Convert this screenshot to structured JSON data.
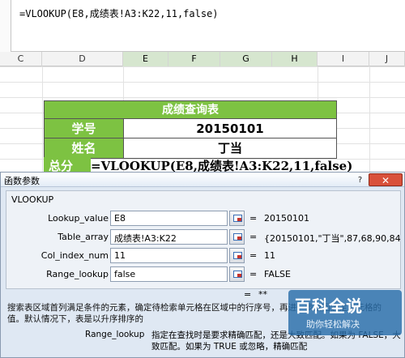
{
  "formula_bar": {
    "text": "=VLOOKUP(E8,成绩表!A3:K22,11,false)"
  },
  "columns": [
    "C",
    "D",
    "E",
    "F",
    "G",
    "H",
    "I",
    "J"
  ],
  "table": {
    "title": "成绩查询表",
    "rows": [
      {
        "label": "学号",
        "value": "20150101"
      },
      {
        "label": "姓名",
        "value": "丁当"
      }
    ],
    "overlay_label": "总分",
    "overlay_formula": "=VLOOKUP(E8,成绩表!A3:K22,11,false)"
  },
  "dialog": {
    "title": "函数参数",
    "help": "?",
    "close": "✕",
    "function_name": "VLOOKUP",
    "args": [
      {
        "label": "Lookup_value",
        "value": "E8",
        "result": "20150101"
      },
      {
        "label": "Table_array",
        "value": "成绩表!A3:K22",
        "result": "{20150101,\"丁当\",87,68,90,84,85,41"
      },
      {
        "label": "Col_index_num",
        "value": "11",
        "result": "11"
      },
      {
        "label": "Range_lookup",
        "value": "false",
        "result": "FALSE"
      }
    ],
    "equals": "=",
    "total_result": "**",
    "description": "搜索表区域首列满足条件的元素，确定待检索单元格在区域中的行序号，再进一步返回选定单元格的值。默认情况下，表是以升序排序的",
    "param_label": "Range_lookup",
    "param_description": "指定在查找时是要求精确匹配，还是大致匹配。如果为 FALSE，大致匹配。如果为 TRUE 或忽略，精确匹配"
  },
  "watermark": {
    "title": "百科全说",
    "subtitle": "助你轻松解决"
  }
}
